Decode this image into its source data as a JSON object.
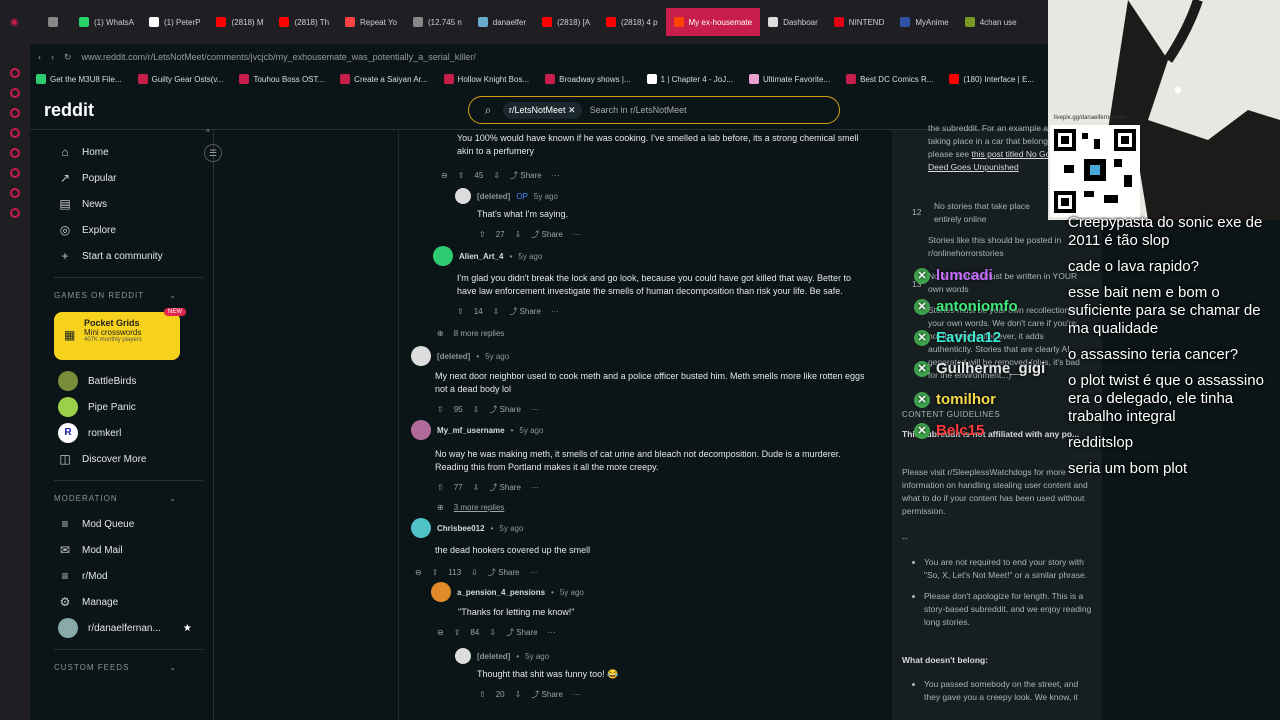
{
  "browser": {
    "tabs": [
      {
        "label": "",
        "color": "#888"
      },
      {
        "label": "(1) WhatsA",
        "color": "#25d366"
      },
      {
        "label": "(1) PeterP",
        "color": "#ffffff"
      },
      {
        "label": "(2818) M",
        "color": "#ff0000"
      },
      {
        "label": "(2818) Th",
        "color": "#ff0000"
      },
      {
        "label": "Repeat Yo",
        "color": "#ff4444"
      },
      {
        "label": "(12.745 n",
        "color": "#888"
      },
      {
        "label": "danaelfer",
        "color": "#6ac"
      },
      {
        "label": "(2818) [A",
        "color": "#ff0000"
      },
      {
        "label": "(2818) 4 p",
        "color": "#ff0000"
      },
      {
        "label": "My ex-housemate",
        "color": "#ff4500",
        "active": true
      },
      {
        "label": "Dashboar",
        "color": "#ddd"
      },
      {
        "label": "NINTEND",
        "color": "#e60012"
      },
      {
        "label": "MyAnime",
        "color": "#2e51a2"
      },
      {
        "label": "4chan use",
        "color": "#789922"
      }
    ],
    "url": "www.reddit.com/r/LetsNotMeet/comments/jvcjcb/my_exhousemate_was_potentially_a_serial_killer/",
    "bookmarks": [
      "Get the M3U8 File...",
      "Guilty Gear Osts(v...",
      "Touhou Boss OST...",
      "Create a Saiyan Ar...",
      "Hollow Knight Bos...",
      "Broadway shows |...",
      "1 | Chapter 4 - JoJ...",
      "Ultimate Favorite...",
      "Best DC Comics R...",
      "(180) Interface | E..."
    ]
  },
  "header": {
    "logo": "reddit",
    "search_chip": "r/LetsNotMeet",
    "search_placeholder": "Search in r/LetsNotMeet"
  },
  "sidebar": {
    "nav": [
      "Home",
      "Popular",
      "News",
      "Explore",
      "Start a community"
    ],
    "games_title": "GAMES ON REDDIT",
    "pocket": {
      "title": "Pocket Grids",
      "sub": "Mini crosswords",
      "meta": "407K monthly players",
      "badge": "NEW"
    },
    "games": [
      "BattleBirds",
      "Pipe Panic",
      "romkerl",
      "Discover More"
    ],
    "moderation_title": "MODERATION",
    "moderation": [
      "Mod Queue",
      "Mod Mail",
      "r/Mod",
      "Manage",
      "r/danaelfernan..."
    ],
    "custom_feeds_title": "CUSTOM FEEDS"
  },
  "comments": [
    {
      "id": "c1",
      "user": "",
      "time": "",
      "body": "You 100% would have known if he was cooking. I've smelled a lab before, its a strong chemical smell akin to a perfumery",
      "votes": "45",
      "share": "Share"
    },
    {
      "id": "c2",
      "user": "[deleted]",
      "op": "OP",
      "time": "5y ago",
      "body": "That's what I'm saying.",
      "votes": "27",
      "share": "Share"
    },
    {
      "id": "c3",
      "user": "Alien_Art_4",
      "time": "5y ago",
      "body": "I'm glad you didn't break the lock and go look, because you could have got killed that way. Better to have law enforcement investigate the smells of human decomposition than risk your life. Be safe.",
      "votes": "14",
      "share": "Share"
    },
    {
      "id": "c3m",
      "more": "8 more replies"
    },
    {
      "id": "c4",
      "user": "[deleted]",
      "time": "5y ago",
      "body": "My next door neighbor used to cook meth and a police officer busted him. Meth smells more like rotten eggs not a dead body lol",
      "votes": "95",
      "share": "Share"
    },
    {
      "id": "c5",
      "user": "My_mf_username",
      "time": "5y ago",
      "body": "No way he was making meth, it smells of cat urine and bleach not decomposition. Dude is a murderer. Reading this from Portland makes it all the more creepy.",
      "votes": "77",
      "share": "Share"
    },
    {
      "id": "c5m",
      "more": "3 more replies"
    },
    {
      "id": "c6",
      "user": "Chrisbee012",
      "time": "5y ago",
      "body": "the dead hookers covered up the smell",
      "votes": "113",
      "share": "Share"
    },
    {
      "id": "c7",
      "user": "a_pension_4_pensions",
      "time": "5y ago",
      "body": "\"Thanks for letting me know!\"",
      "votes": "84",
      "share": "Share"
    },
    {
      "id": "c8",
      "user": "[deleted]",
      "time": "5y ago",
      "body": "Thought that shit was funny too! 😂",
      "votes": "20",
      "share": "Share"
    }
  ],
  "rules": {
    "r11_text": "the subreddit. For an example a story taking place in a car that belong here, please see",
    "r11_link1": "this post titled No Good Deed Goes Unpunished",
    "r12_num": "12",
    "r12_title": "No stories that take place entirely online",
    "r12_text": "Stories like this should be posted in r/onlinehorrorstories",
    "r13_num": "13",
    "r13_title": "No AI - stories must be written in YOUR own words",
    "r13_text": "Stories must be your own recollection in your own words. We don't care if you're not the best writer ever, it adds authenticity. Stories that are clearly AI generated will be removed (plus, it's bad for the environment...)",
    "guidelines_title": "CONTENT GUIDELINES",
    "affiliation": "This subreddit is not affiliated with any po...",
    "visit_text": "Please visit r/SleeplessWatchdogs for more information on handling stealing user content and what to do if your content has been used without permission.",
    "dash": "--",
    "bullets": [
      "You are not required to end your story with \"So, X, Let's Not Meet!\" or a similar phrase.",
      "Please don't apologize for length. This is a story-based subreddit, and we enjoy reading long stories."
    ],
    "doesnt_belong": "What doesn't belong:",
    "bullet3": "You passed somebody on the street, and they gave you a creepy look. We know, it"
  },
  "stream": {
    "qr_label": "livepix.gg/danaelfernandes",
    "chat": [
      "Creepypasta do sonic exe de 2011 é tão slop",
      "cade o lava rapido?",
      "esse bait nem e bom o suficiente para se chamar de ma qualidade",
      "o assassino teria cancer?",
      "o plot twist é que o assassino era o delegado, ele tinha trabalho integral",
      "redditslop",
      "seria um bom plot"
    ],
    "ggs": [
      {
        "name": "lumcadi",
        "color": "#c86bff"
      },
      {
        "name": "antoniomfo",
        "color": "#3ee87a"
      },
      {
        "name": "Eavida12",
        "color": "#3ee8d0"
      },
      {
        "name": "Guilherme_gigi",
        "color": "#e6e6e6"
      },
      {
        "name": "tomilhor",
        "color": "#f5d94a"
      },
      {
        "name": "Belc15",
        "color": "#ff3b3b"
      }
    ]
  }
}
